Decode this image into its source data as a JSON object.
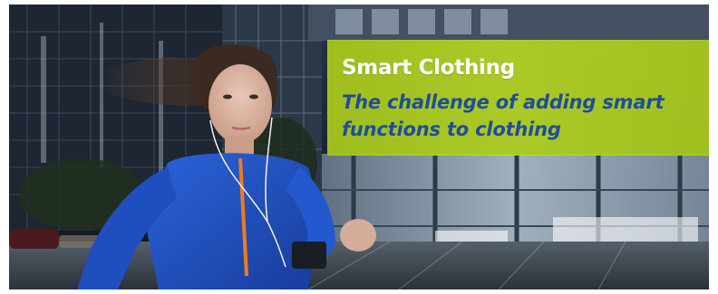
{
  "banner": {
    "title": "Smart Clothing",
    "subtitle": "The challenge of adding smart functions to clothing",
    "background_color": "#b3d226",
    "title_color": "#ffffff",
    "subtitle_color": "#1f4d9c"
  },
  "photo": {
    "subject": "woman-running-in-blue-jacket-with-earphones",
    "setting": "city-night-glass-buildings",
    "accent_color": "#1f4fbf"
  }
}
